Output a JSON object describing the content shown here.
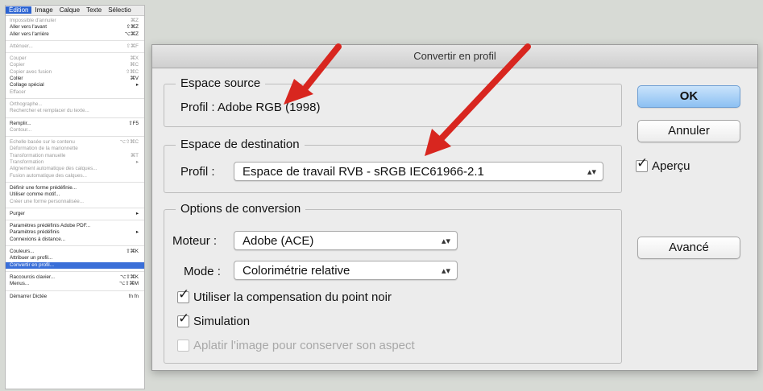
{
  "menubar": {
    "items": [
      "Édition",
      "Image",
      "Calque",
      "Texte",
      "Sélectio"
    ]
  },
  "edit_menu": {
    "items": [
      {
        "label": "Impossible d'annuler",
        "shortcut": "⌘Z"
      },
      {
        "label": "Aller vers l'avant",
        "shortcut": "⇧⌘Z"
      },
      {
        "label": "Aller vers l'arrière",
        "shortcut": "⌥⌘Z"
      },
      {
        "label": "Atténuer...",
        "shortcut": "⇧⌘F"
      },
      {
        "label": "Couper",
        "shortcut": "⌘X"
      },
      {
        "label": "Copier",
        "shortcut": "⌘C"
      },
      {
        "label": "Copier avec fusion",
        "shortcut": "⇧⌘C"
      },
      {
        "label": "Coller",
        "shortcut": "⌘V"
      },
      {
        "label": "Collage spécial",
        "shortcut": "▸"
      },
      {
        "label": "Effacer",
        "shortcut": ""
      },
      {
        "label": "Orthographe...",
        "shortcut": ""
      },
      {
        "label": "Rechercher et remplacer du texte...",
        "shortcut": ""
      },
      {
        "label": "Remplir...",
        "shortcut": "⇧F5"
      },
      {
        "label": "Contour...",
        "shortcut": ""
      },
      {
        "label": "Echelle basée sur le contenu",
        "shortcut": "⌥⇧⌘C"
      },
      {
        "label": "Déformation de la marionnette",
        "shortcut": ""
      },
      {
        "label": "Transformation manuelle",
        "shortcut": "⌘T"
      },
      {
        "label": "Transformation",
        "shortcut": "▸"
      },
      {
        "label": "Alignement automatique des calques...",
        "shortcut": ""
      },
      {
        "label": "Fusion automatique des calques...",
        "shortcut": ""
      },
      {
        "label": "Définir une forme prédéfinie...",
        "shortcut": ""
      },
      {
        "label": "Utiliser comme motif...",
        "shortcut": ""
      },
      {
        "label": "Créer une forme personnalisée...",
        "shortcut": ""
      },
      {
        "label": "Purger",
        "shortcut": "▸"
      },
      {
        "label": "Paramètres prédéfinis Adobe PDF...",
        "shortcut": ""
      },
      {
        "label": "Paramètres prédéfinis",
        "shortcut": "▸"
      },
      {
        "label": "Connexions à distance...",
        "shortcut": ""
      },
      {
        "label": "Couleurs...",
        "shortcut": "⇧⌘K"
      },
      {
        "label": "Attribuer un profil...",
        "shortcut": ""
      },
      {
        "label": "Convertir en profil...",
        "shortcut": ""
      },
      {
        "label": "Raccourcis clavier...",
        "shortcut": "⌥⇧⌘K"
      },
      {
        "label": "Menus...",
        "shortcut": "⌥⇧⌘M"
      },
      {
        "label": "Démarrer Dictée",
        "shortcut": "fn fn"
      }
    ]
  },
  "dialog": {
    "title": "Convertir en profil",
    "source": {
      "legend": "Espace source",
      "profile_label": "Profil :",
      "profile_value": "Adobe RGB (1998)"
    },
    "destination": {
      "legend": "Espace de destination",
      "profile_label": "Profil :",
      "profile_value": "Espace de travail RVB - sRGB IEC61966-2.1"
    },
    "options": {
      "legend": "Options de conversion",
      "engine_label": "Moteur :",
      "engine_value": "Adobe (ACE)",
      "mode_label": "Mode :",
      "mode_value": "Colorimétrie relative",
      "black_point": "Utiliser la compensation du point noir",
      "simulation": "Simulation",
      "flatten": "Aplatir l'image pour conserver son aspect"
    },
    "buttons": {
      "ok": "OK",
      "cancel": "Annuler",
      "preview": "Aperçu",
      "advanced": "Avancé"
    },
    "select_arrows": "⌃⌄"
  },
  "colors": {
    "arrow": "#d8261f",
    "default_button": "#8cc0f2",
    "menu_highlight": "#3a6fd8"
  }
}
